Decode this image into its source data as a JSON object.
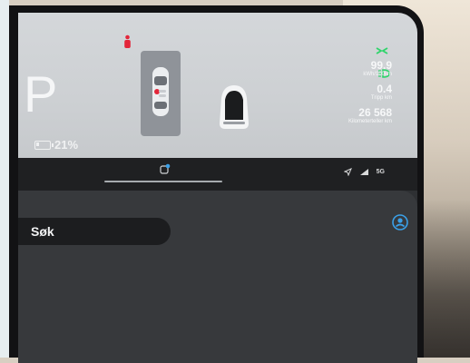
{
  "gear": "P",
  "battery": {
    "percent_label": "21%",
    "level": 0.21
  },
  "trip": [
    {
      "value": "99.9",
      "unit": "kWh/100km"
    },
    {
      "value": "0.4",
      "unit": "Tripp km"
    },
    {
      "value": "26 568",
      "unit": "Kilometerteller km"
    }
  ],
  "status_bar": {
    "network": "5G"
  },
  "search": {
    "placeholder": "Søk"
  },
  "colors": {
    "indicator_green": "#2fd46b",
    "warning_red": "#e3263a",
    "accent_blue": "#3aa0e8"
  }
}
